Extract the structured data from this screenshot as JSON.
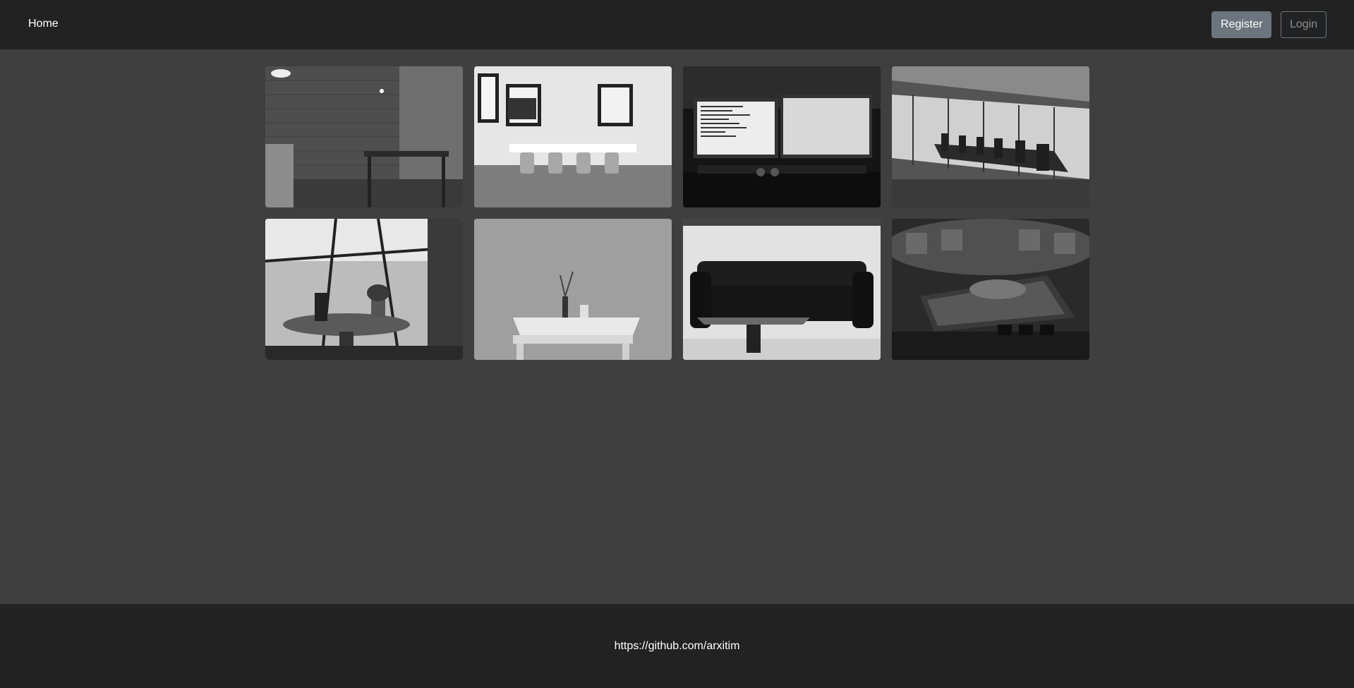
{
  "nav": {
    "home_label": "Home",
    "register_label": "Register",
    "login_label": "Login"
  },
  "gallery": {
    "images": [
      {
        "name": "brick-wall-cafe-photo"
      },
      {
        "name": "white-meeting-room-photo"
      },
      {
        "name": "dual-monitor-desk-photo"
      },
      {
        "name": "glass-conference-room-photo"
      },
      {
        "name": "cafe-table-window-photo"
      },
      {
        "name": "white-table-vase-photo"
      },
      {
        "name": "leather-sofa-photo"
      },
      {
        "name": "spaceship-bridge-photo"
      }
    ]
  },
  "footer": {
    "link_text": "https://github.com/arxitim"
  },
  "colors": {
    "navbar_bg": "#222222",
    "page_bg": "#3f3f3f",
    "footer_bg": "#222222",
    "register_bg": "#6c757d"
  }
}
